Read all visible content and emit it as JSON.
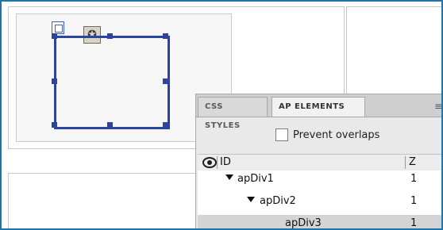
{
  "panel": {
    "tabs": [
      {
        "label": "CSS STYLES"
      },
      {
        "label": "AP ELEMENTS"
      }
    ],
    "menu_icon": "panel-menu-icon",
    "prevent_overlaps_label": "Prevent overlaps",
    "prevent_overlaps_checked": false,
    "list": {
      "headers": {
        "id": "ID",
        "z": "Z"
      },
      "rows": [
        {
          "name": "apDiv1",
          "z": "1",
          "expanded": true
        },
        {
          "name": "apDiv2",
          "z": "1",
          "expanded": true
        },
        {
          "name": "apDiv3",
          "z": "1",
          "selected": true
        }
      ]
    }
  },
  "canvas": {
    "selection_color": "#2b44a0",
    "panel_icons": {
      "eye": "eye-icon",
      "move": "move-icon",
      "selector": "element-selector-icon"
    }
  }
}
